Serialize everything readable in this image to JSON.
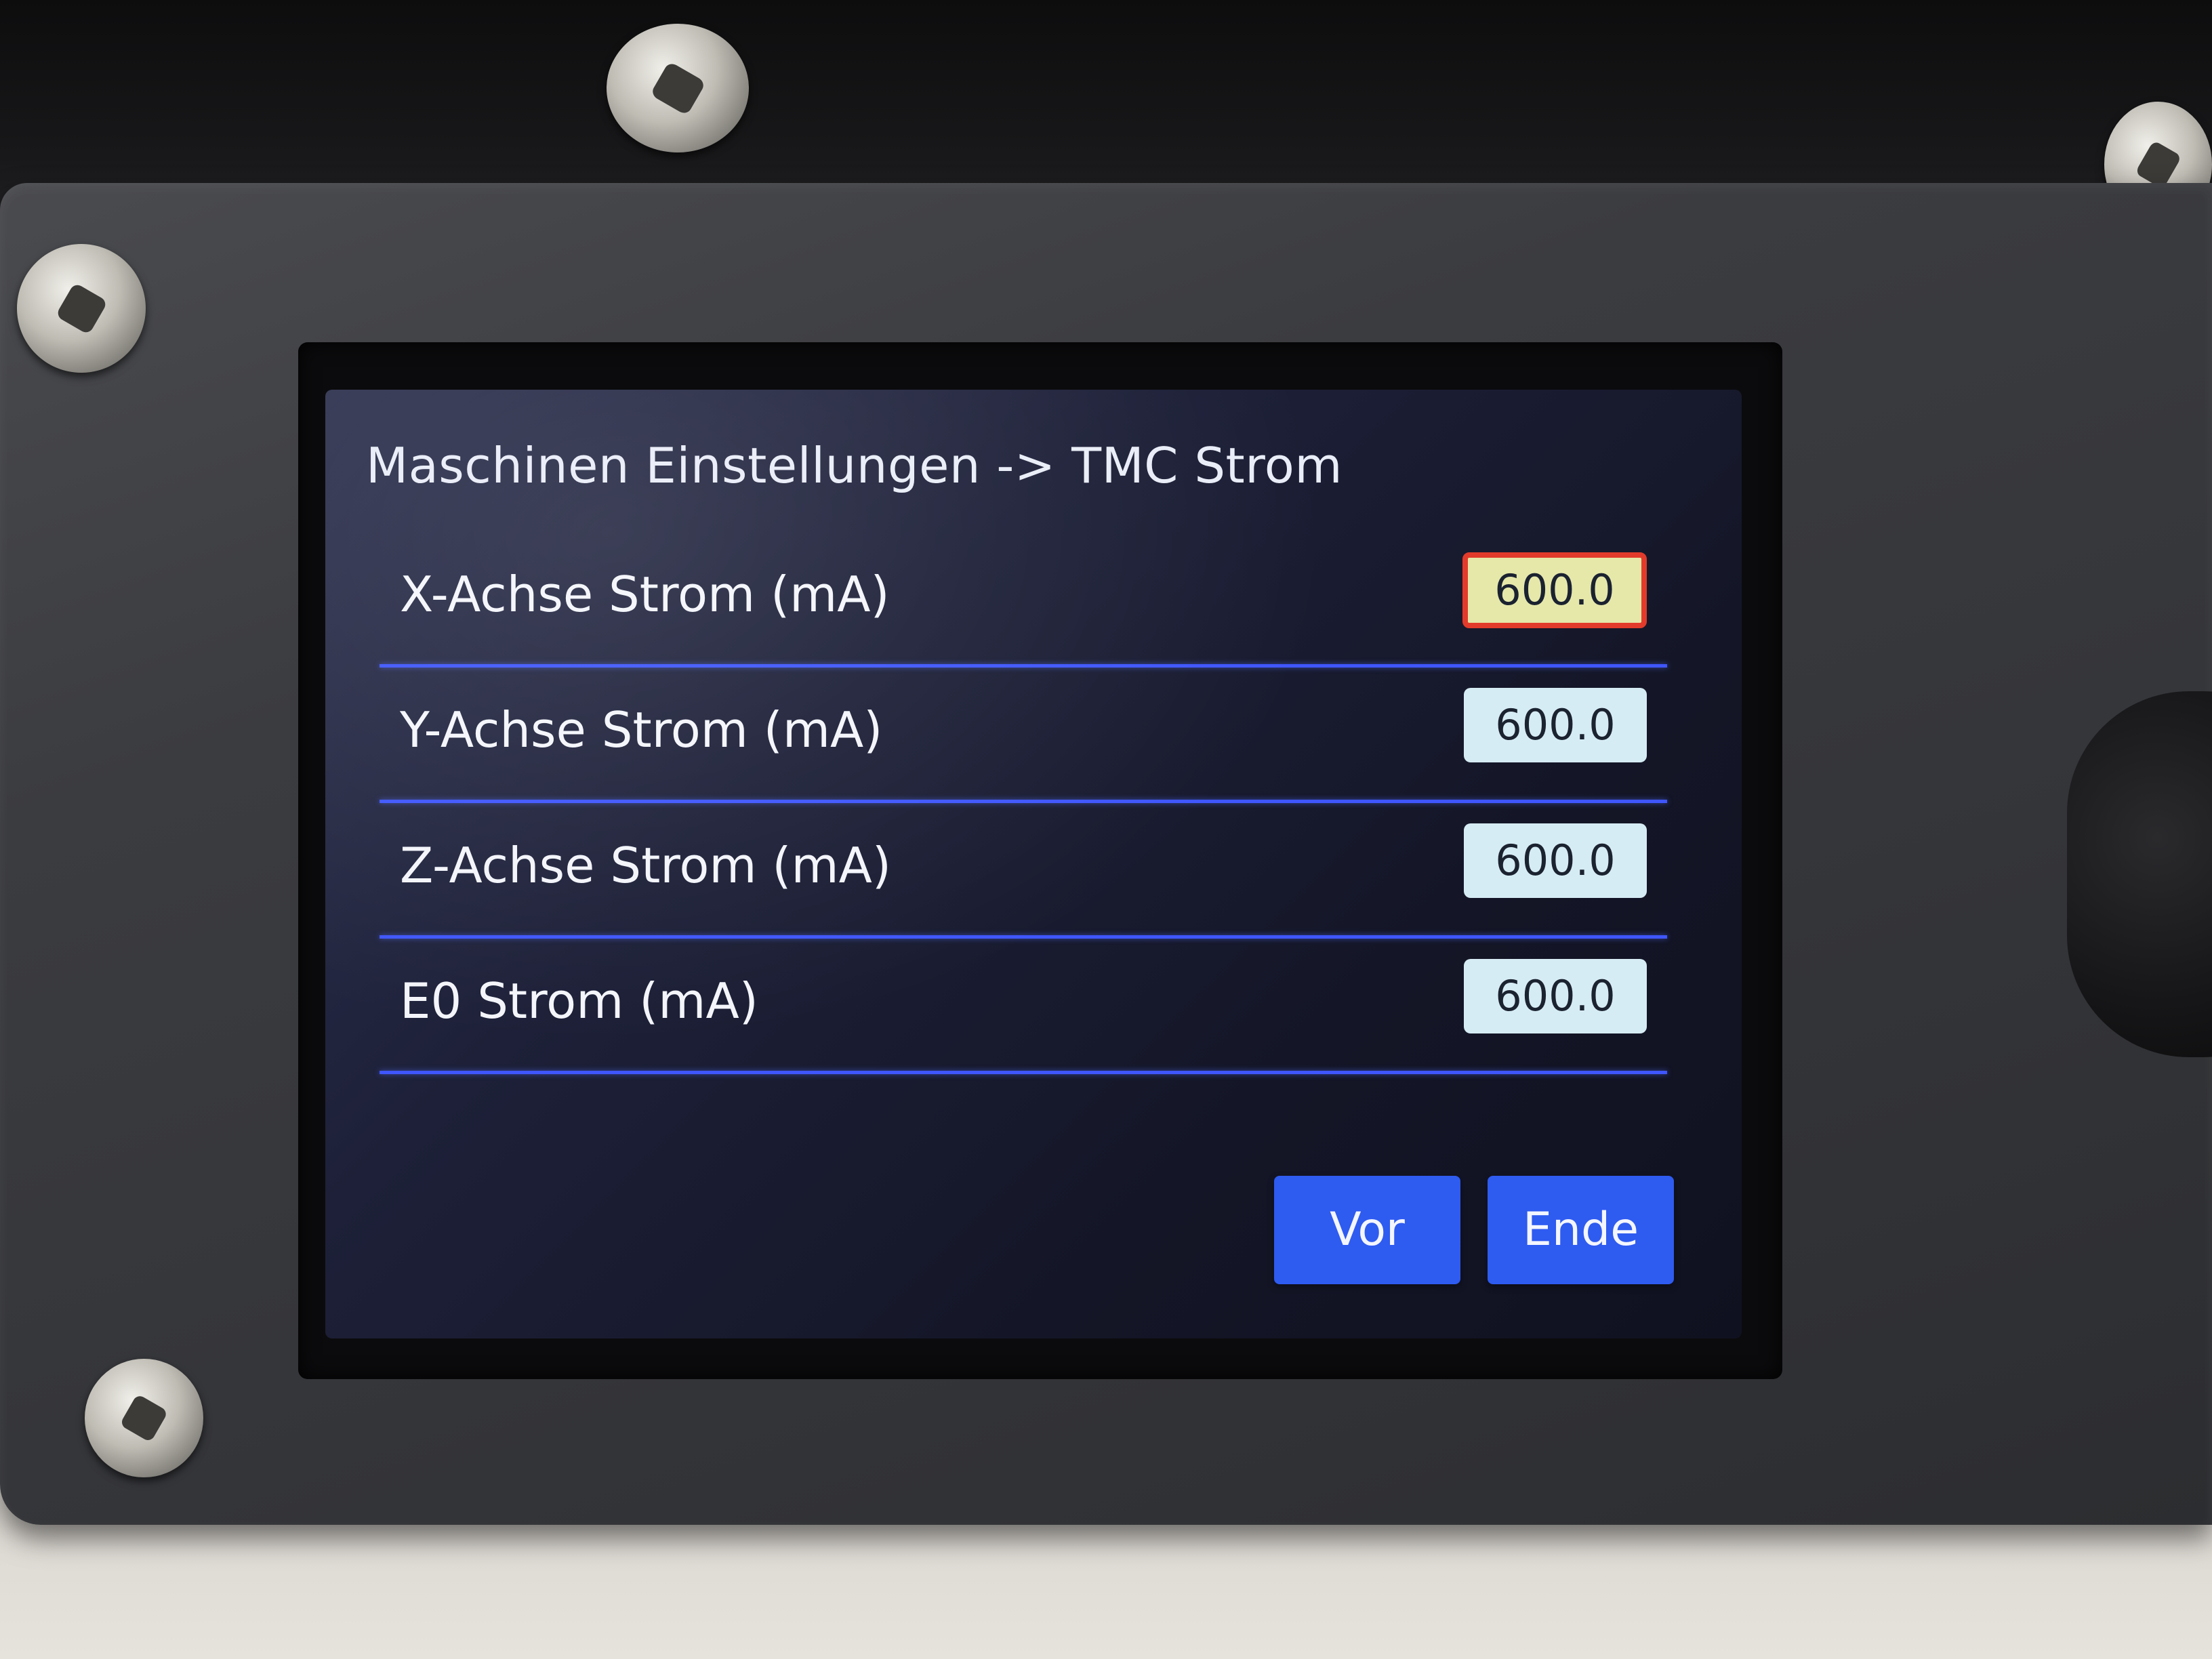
{
  "screen": {
    "title": "Maschinen Einstellungen -> TMC Strom"
  },
  "settings": [
    {
      "label": "X-Achse Strom (mA)",
      "value": "600.0",
      "selected": true
    },
    {
      "label": "Y-Achse Strom (mA)",
      "value": "600.0",
      "selected": false
    },
    {
      "label": "Z-Achse Strom (mA)",
      "value": "600.0",
      "selected": false
    },
    {
      "label": "E0 Strom (mA)",
      "value": "600.0",
      "selected": false
    }
  ],
  "buttons": {
    "next_label": "Vor",
    "exit_label": "Ende"
  },
  "colors": {
    "divider": "#3f56ff",
    "button": "#2e5bf0",
    "value_box": "#d6ecf4",
    "value_box_selected_fill": "#e5e8a9",
    "value_box_selected_border": "#e33b2b"
  }
}
